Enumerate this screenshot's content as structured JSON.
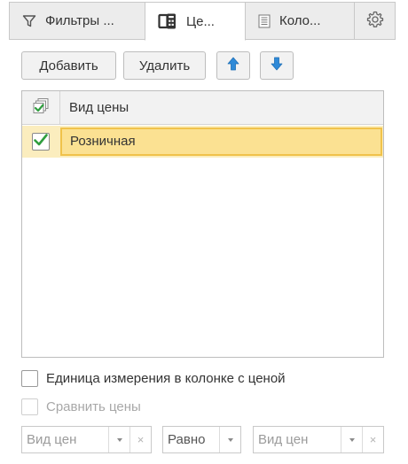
{
  "tabs": [
    {
      "label": "Фильтры ...",
      "icon": "filter-icon"
    },
    {
      "label": "Це...",
      "icon": "price-list-icon"
    },
    {
      "label": "Коло...",
      "icon": "columns-icon"
    },
    {
      "label": "",
      "icon": "gear-icon"
    }
  ],
  "toolbar": {
    "add_label": "Добавить",
    "delete_label": "Удалить",
    "up_icon": "arrow-up-icon",
    "down_icon": "arrow-down-icon"
  },
  "table": {
    "header": "Вид цены",
    "rows": [
      {
        "checked": true,
        "label": "Розничная"
      }
    ]
  },
  "options": {
    "unit_in_price_column": "Единица измерения в колонке с ценой",
    "compare_prices": "Сравнить цены"
  },
  "filters": {
    "field1_placeholder": "Вид цен",
    "condition_value": "Равно",
    "field2_placeholder": "Вид цен"
  },
  "colors": {
    "selected_row": "#fbedbe",
    "selected_cell": "#fbe192",
    "arrow_blue": "#2f8ad8",
    "check_green": "#2f9e3e"
  }
}
